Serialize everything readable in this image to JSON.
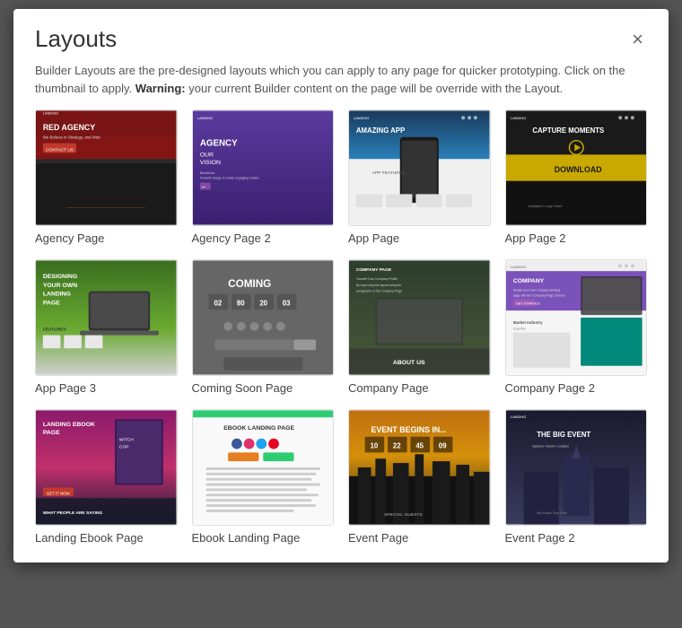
{
  "modal": {
    "title": "Layouts",
    "close_label": "×",
    "description_before": "Builder Layouts are the pre-designed layouts which you can apply to any page for quicker prototyping. Click on the thumbnail to apply. ",
    "description_warning_label": "Warning:",
    "description_after": " your current Builder content on the page will be override with the Layout."
  },
  "layouts": [
    {
      "id": "agency-page",
      "label": "Agency Page",
      "thumb_type": "agency-1"
    },
    {
      "id": "agency-page-2",
      "label": "Agency Page 2",
      "thumb_type": "agency-2"
    },
    {
      "id": "app-page",
      "label": "App Page",
      "thumb_type": "app-1"
    },
    {
      "id": "app-page-2",
      "label": "App Page 2",
      "thumb_type": "app-2"
    },
    {
      "id": "app-page-3",
      "label": "App Page 3",
      "thumb_type": "app-3"
    },
    {
      "id": "coming-soon-page",
      "label": "Coming Soon Page",
      "thumb_type": "coming-soon"
    },
    {
      "id": "company-page",
      "label": "Company Page",
      "thumb_type": "company-1"
    },
    {
      "id": "company-page-2",
      "label": "Company Page 2",
      "thumb_type": "company-2"
    },
    {
      "id": "landing-ebook-page",
      "label": "Landing Ebook Page",
      "thumb_type": "ebook-1"
    },
    {
      "id": "ebook-landing-page",
      "label": "Ebook Landing Page",
      "thumb_type": "ebook-2"
    },
    {
      "id": "event-page",
      "label": "Event Page",
      "thumb_type": "event-1"
    },
    {
      "id": "event-page-2",
      "label": "Event Page 2",
      "thumb_type": "event-2"
    }
  ]
}
